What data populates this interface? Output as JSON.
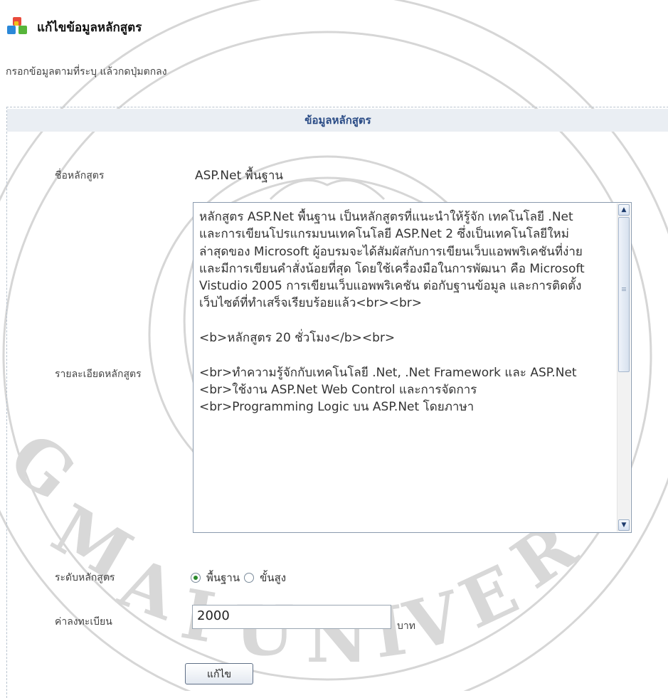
{
  "header": {
    "title": "แก้ไขข้อมูลหลักสูตร",
    "logo_icon": "cubes-icon"
  },
  "instruction": "กรอกข้อมูลตามที่ระบุ แล้วกดปุ่มตกลง",
  "panel": {
    "heading": "ข้อมูลหลักสูตร",
    "course_name_label": "ชื่อหลักสูตร",
    "course_name_value": "ASP.Net พื้นฐาน",
    "details_label": "รายละเอียดหลักสูตร",
    "details_value": "หลักสูตร ASP.Net พื้นฐาน เป็นหลักสูตรที่แนะนำให้รู้จัก เทคโนโลยี .Net และการเขียนโปรแกรมบนเทคโนโลยี ASP.Net 2 ซึ่งเป็นเทคโนโลยีใหม่ล่าสุดของ Microsoft ผู้อบรมจะได้สัมผัสกับการเขียนเว็บแอพพริเคชันที่ง่าย และมีการเขียนคำสั่งน้อยที่สุด โดยใช้เครื่องมือในการพัฒนา คือ Microsoft Vistudio 2005 การเขียนเว็บแอพพริเคชัน ต่อกับฐานข้อมูล และการติดตั้งเว็บไซต์ที่ทำเสร็จเรียบร้อยแล้ว<br><br>\n\n<b>หลักสูตร 20 ชั่วโมง</b><br>\n\n<br>ทำความรู้จักกับเทคโนโลยี .Net, .Net Framework และ ASP.Net\n<br>ใช้งาน ASP.Net Web Control และการจัดการ\n<br>Programming Logic บน ASP.Net โดยภาษา",
    "level_label": "ระดับหลักสูตร",
    "level_options": [
      "พื้นฐาน",
      "ขั้นสูง"
    ],
    "level_selected": "พื้นฐาน",
    "fee_label": "ค่าลงทะเบียน",
    "fee_value": "2000",
    "fee_unit": "บาท",
    "submit_label": "แก้ไข"
  },
  "colors": {
    "panel_heading_text": "#2b4c86",
    "panel_heading_bg": "#eaeef3",
    "radio_checked": "#2a8a2a"
  }
}
